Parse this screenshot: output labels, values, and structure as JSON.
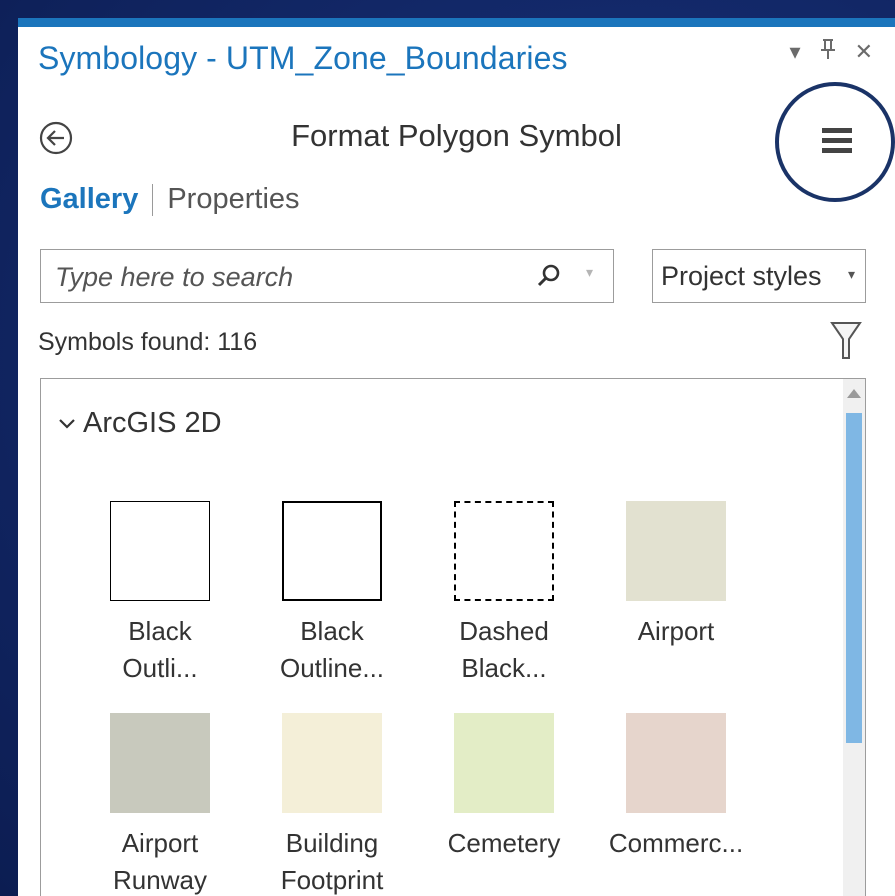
{
  "pane": {
    "title": "Symbology - UTM_Zone_Boundaries",
    "controls": {
      "dropdown_glyph": "▾",
      "pin_glyph": "ᚚ",
      "close_glyph": "✕"
    }
  },
  "nav": {
    "back_icon": "back-arrow-icon",
    "title": "Format Polygon Symbol",
    "menu_icon": "hamburger-menu-icon"
  },
  "tabs": [
    {
      "label": "Gallery",
      "active": true
    },
    {
      "label": "Properties",
      "active": false
    }
  ],
  "search": {
    "placeholder": "Type here to search",
    "value": "",
    "icon": "search-icon"
  },
  "styles_dropdown": {
    "selected": "Project styles"
  },
  "symbols_found": "Symbols found: 116",
  "gallery": {
    "group": "ArcGIS 2D",
    "symbols": [
      {
        "label": "Black\nOutli...",
        "fill": "#ffffff",
        "stroke": "#000000",
        "style": "solid-thin"
      },
      {
        "label": "Black\nOutline...",
        "fill": "#ffffff",
        "stroke": "#000000",
        "style": "solid-thick"
      },
      {
        "label": "Dashed\nBlack...",
        "fill": "#ffffff",
        "stroke": "#000000",
        "style": "dashed"
      },
      {
        "label": "Airport",
        "fill": "#e2e1d0",
        "stroke": "none",
        "style": "fill"
      },
      {
        "label": "Airport\nRunway",
        "fill": "#c8c9bd",
        "stroke": "none",
        "style": "fill"
      },
      {
        "label": "Building\nFootprint",
        "fill": "#f4efd8",
        "stroke": "none",
        "style": "fill"
      },
      {
        "label": "Cemetery",
        "fill": "#e3edc6",
        "stroke": "none",
        "style": "fill"
      },
      {
        "label": "Commerc...",
        "fill": "#e6d5cc",
        "stroke": "none",
        "style": "fill"
      }
    ]
  },
  "colors": {
    "accent": "#1b75bc",
    "background": "#13296a",
    "highlight_circle": "#1a3367"
  }
}
